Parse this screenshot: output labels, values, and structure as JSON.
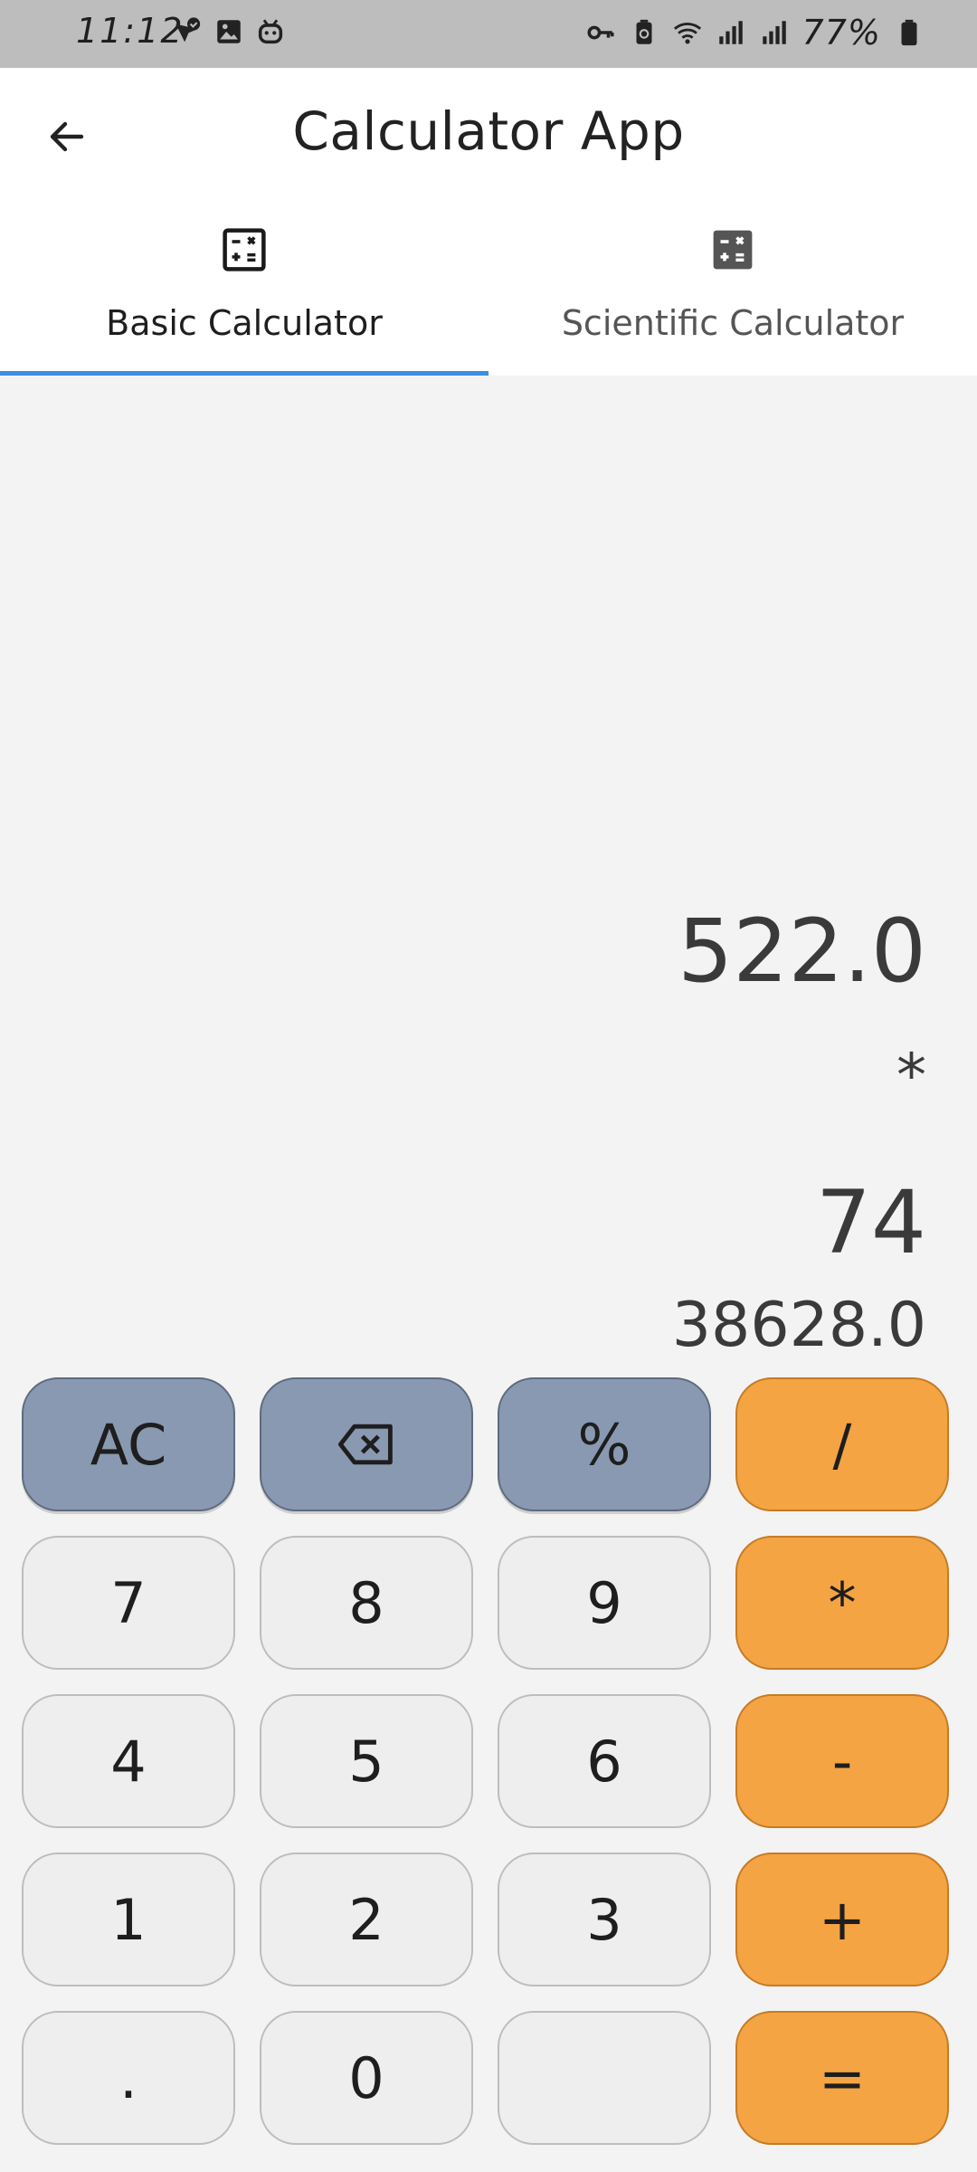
{
  "status_bar": {
    "time": "11:12",
    "battery": "77%"
  },
  "app_bar": {
    "title": "Calculator App",
    "back_icon": "arrow-left-icon"
  },
  "tabs": [
    {
      "label": "Basic Calculator",
      "icon": "calculator-outline-icon",
      "active": true
    },
    {
      "label": "Scientific Calculator",
      "icon": "calculator-filled-icon",
      "active": false
    }
  ],
  "display": {
    "first_operand": "522.0",
    "operator": "*",
    "second_operand": "74",
    "result": "38628.0"
  },
  "keypad": {
    "rows": [
      [
        "AC",
        "⌫",
        "%",
        "/"
      ],
      [
        "7",
        "8",
        "9",
        "*"
      ],
      [
        "4",
        "5",
        "6",
        "-"
      ],
      [
        "1",
        "2",
        "3",
        "+"
      ],
      [
        ".",
        "0",
        "",
        "="
      ]
    ]
  },
  "colors": {
    "function_key": "#8a99b2",
    "number_key": "#eeeeee",
    "operator_key": "#f4a443",
    "tab_indicator": "#3a8ee6",
    "status_bar": "#bdbdbd"
  }
}
